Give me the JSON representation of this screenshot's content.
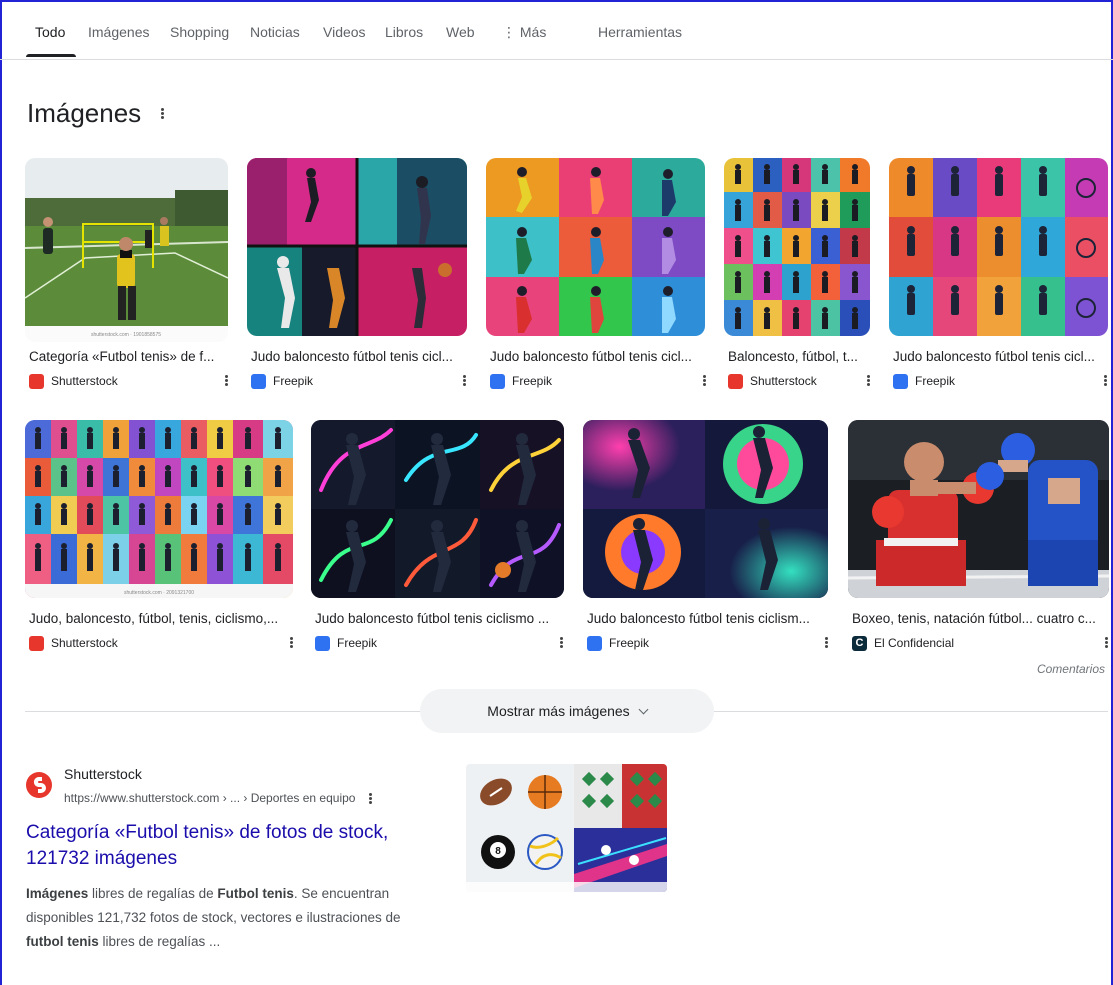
{
  "tabs": [
    "Todo",
    "Imágenes",
    "Shopping",
    "Noticias",
    "Videos",
    "Libros",
    "Web",
    "⋮ Más",
    "Herramientas"
  ],
  "images_section": {
    "heading": "Imágenes",
    "row1": [
      {
        "title": "Categoría «Futbol tenis» de f...",
        "source": "Shutterstock"
      },
      {
        "title": "Judo baloncesto fútbol tenis cicl...",
        "source": "Freepik"
      },
      {
        "title": "Judo baloncesto fútbol tenis cicl...",
        "source": "Freepik"
      },
      {
        "title": "Baloncesto, fútbol, t...",
        "source": "Shutterstock"
      },
      {
        "title": "Judo baloncesto fútbol tenis cicl...",
        "source": "Freepik"
      }
    ],
    "row2": [
      {
        "title": "Judo, baloncesto, fútbol, tenis, ciclismo,...",
        "source": "Shutterstock"
      },
      {
        "title": "Judo baloncesto fútbol tenis ciclismo ...",
        "source": "Freepik"
      },
      {
        "title": "Judo baloncesto fútbol tenis ciclism...",
        "source": "Freepik"
      },
      {
        "title": "Boxeo, tenis, natación fútbol... cuatro c...",
        "source": "El Confidencial"
      }
    ],
    "thumb_captions": {
      "futbol": "shutterstock.com · 1901858575",
      "grid": "shutterstock.com · 2091321700"
    },
    "source_icon_letters": {
      "el_confidencial": "C"
    },
    "feedback": "Comentarios",
    "show_more": "Mostrar más imágenes"
  },
  "result": {
    "site": "Shutterstock",
    "url": "https://www.shutterstock.com › ... › Deportes en equipo",
    "title": "Categoría «Futbol tenis» de fotos de stock, 121732 imágenes",
    "snippet": {
      "b1": "Imágenes",
      "t1": " libres de regalías de ",
      "b2": "Futbol tenis",
      "t2": ". Se encuentran disponibles 121,732 fotos de stock, vectores e ilustraciones de ",
      "b3": "futbol tenis",
      "t3": " libres de regalías ..."
    }
  },
  "colors": {
    "link": "#1a0dab",
    "shutterstock": "#e7362c",
    "freepik": "#2f72f1",
    "frame": "#2323d6"
  }
}
